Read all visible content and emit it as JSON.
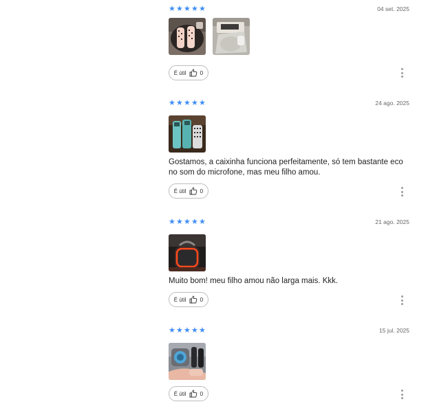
{
  "ui": {
    "star_color": "#3f8ef5",
    "star_glyph": "★",
    "helpful_label": "É útil"
  },
  "reviews": [
    {
      "rating": 5,
      "date": "04 set. 2025",
      "text": "",
      "photos": [
        "photo-pink-microphones-bag",
        "photo-microphone-box"
      ],
      "helpful_count": "0"
    },
    {
      "rating": 5,
      "date": "24 ago. 2025",
      "text": "Gostamos, a caixinha funciona perfeitamente, só tem bastante eco no som do microfone, mas meu filho amou.",
      "photos": [
        "photo-teal-speaker-microphones"
      ],
      "helpful_count": "0"
    },
    {
      "rating": 5,
      "date": "21 ago. 2025",
      "text": "Muito bom! meu filho amou não larga mais. Kkk.",
      "photos": [
        "photo-speaker-red-light"
      ],
      "helpful_count": "0"
    },
    {
      "rating": 5,
      "date": "15 jul. 2025",
      "text": "",
      "photos": [
        "photo-speaker-pink-mic-in-hand"
      ],
      "helpful_count": "0"
    }
  ]
}
